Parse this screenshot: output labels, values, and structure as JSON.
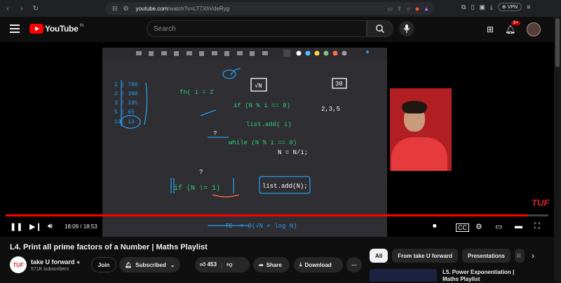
{
  "browser": {
    "url_host": "youtube.com",
    "url_path": "/watch?v=LT7XhVdeRyg",
    "vpn_label": "VPN"
  },
  "header": {
    "logo_text": "YouTube",
    "logo_country": "IN",
    "search_placeholder": "Search",
    "notification_count": "9+"
  },
  "player": {
    "time_current": "18:09",
    "time_separator": " / ",
    "time_total": "18:53",
    "progress": 0.961,
    "watermark": "TUF"
  },
  "video": {
    "title": "L4. Print all prime factors of a Number | Maths Playlist",
    "channel_name": "take U forward",
    "channel_avatar_text": "TUF",
    "subscribers": "571K subscribers",
    "join_label": "Join",
    "subscribed_label": "Subscribed",
    "likes": "453",
    "share_label": "Share",
    "download_label": "Download"
  },
  "sidebar": {
    "chips": [
      "All",
      "From take U forward",
      "Presentations",
      "R"
    ],
    "rec_title_line1": "L5. Power Exponentiation |",
    "rec_title_line2": "Maths Playlist"
  },
  "colors": {
    "accent": "#ff0000",
    "board_text": "#2ed37a",
    "board_blue": "#2c9be8"
  }
}
